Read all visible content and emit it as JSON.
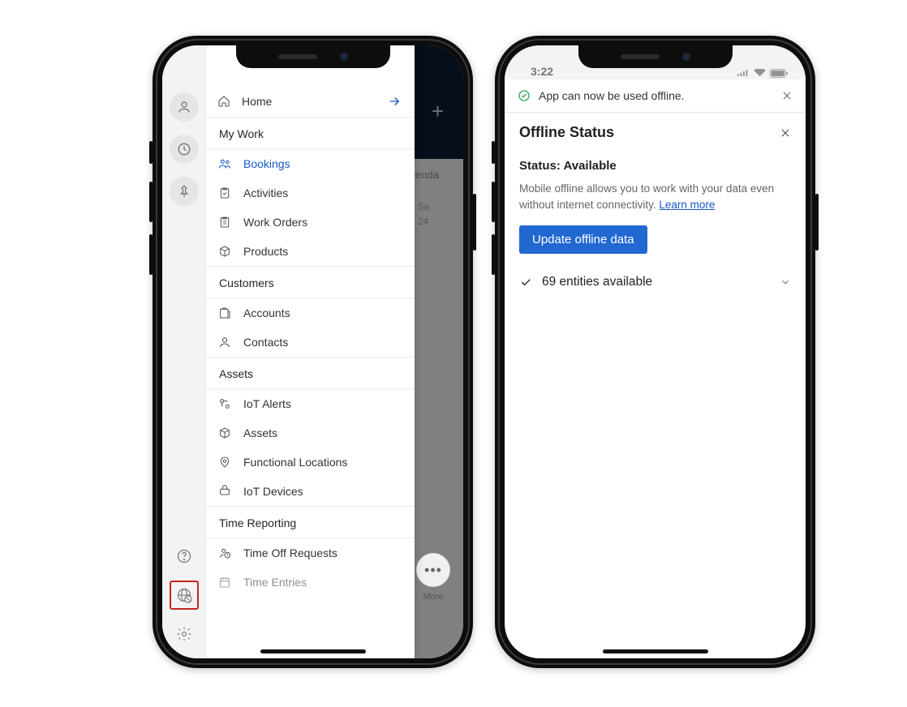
{
  "left": {
    "background": {
      "tab_label": "genda",
      "day_abbrev": "Sa",
      "day_num": "24",
      "more_label": "More"
    },
    "nav": {
      "home": "Home",
      "groups": [
        {
          "title": "My Work",
          "items": [
            {
              "icon": "people",
              "label": "Bookings",
              "active": true
            },
            {
              "icon": "clipboard-check",
              "label": "Activities"
            },
            {
              "icon": "clipboard",
              "label": "Work Orders"
            },
            {
              "icon": "box",
              "label": "Products"
            }
          ]
        },
        {
          "title": "Customers",
          "items": [
            {
              "icon": "account",
              "label": "Accounts"
            },
            {
              "icon": "person",
              "label": "Contacts"
            }
          ]
        },
        {
          "title": "Assets",
          "items": [
            {
              "icon": "iot-alert",
              "label": "IoT Alerts"
            },
            {
              "icon": "box",
              "label": "Assets"
            },
            {
              "icon": "location",
              "label": "Functional Locations"
            },
            {
              "icon": "iot-device",
              "label": "IoT Devices"
            }
          ]
        },
        {
          "title": "Time Reporting",
          "items": [
            {
              "icon": "timeoff",
              "label": "Time Off Requests"
            },
            {
              "icon": "calendar",
              "label": "Time Entries"
            }
          ]
        }
      ]
    }
  },
  "right": {
    "status_time": "3:22",
    "toast": "App can now be used offline.",
    "panel_title": "Offline Status",
    "status_label": "Status:",
    "status_value": "Available",
    "description": "Mobile offline allows you to work with your data even without internet connectivity.",
    "learn_more": "Learn more",
    "update_button": "Update offline data",
    "entities_text": "69 entities available"
  }
}
